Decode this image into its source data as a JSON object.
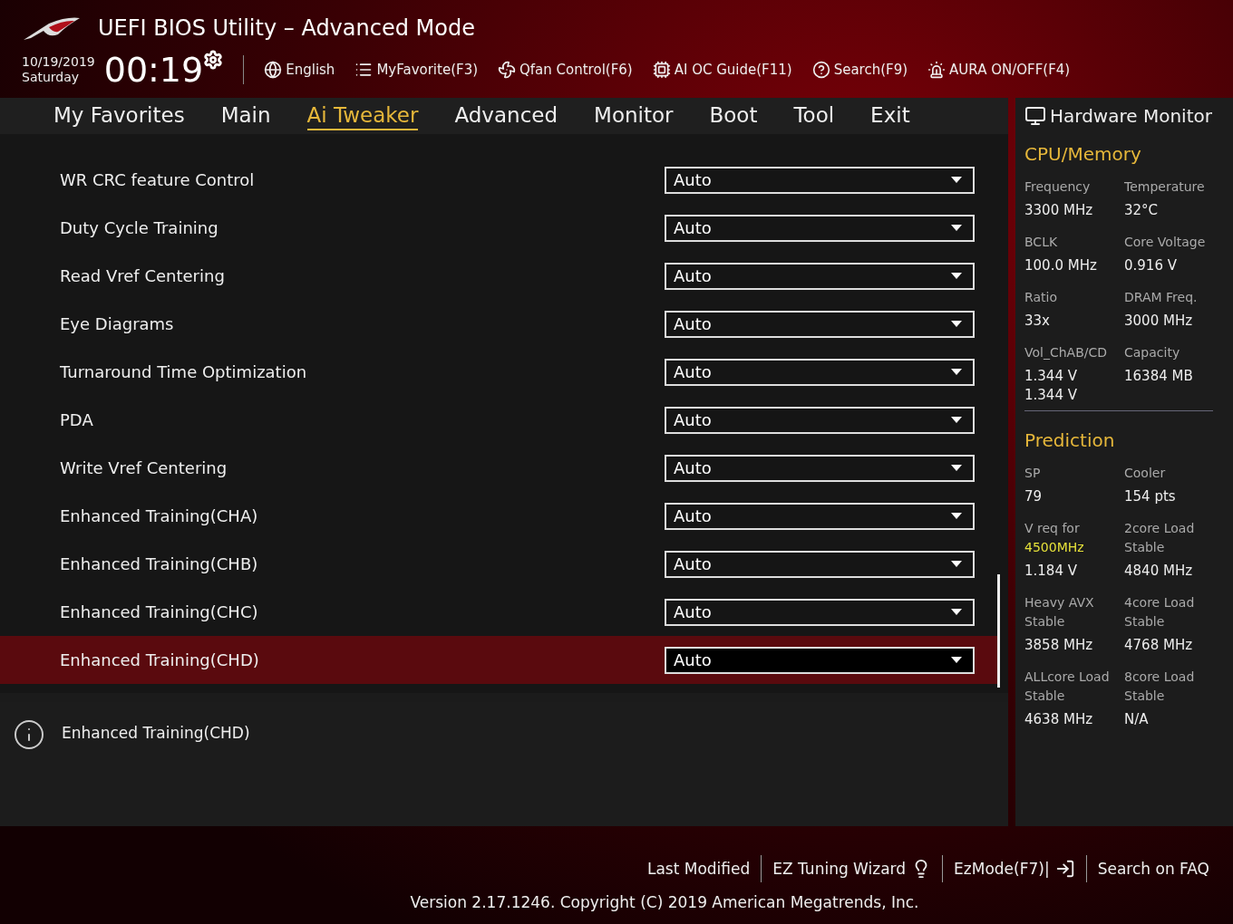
{
  "window": {
    "title": "UEFI BIOS Utility – Advanced Mode"
  },
  "clock": {
    "date": "10/19/2019",
    "day": "Saturday",
    "time": "00:19"
  },
  "toolbar": [
    {
      "label": "English"
    },
    {
      "label": "MyFavorite(F3)"
    },
    {
      "label": "Qfan Control(F6)"
    },
    {
      "label": "AI OC Guide(F11)"
    },
    {
      "label": "Search(F9)"
    },
    {
      "label": "AURA ON/OFF(F4)"
    }
  ],
  "tabs": [
    {
      "label": "My Favorites",
      "selected": false
    },
    {
      "label": "Main",
      "selected": false
    },
    {
      "label": "Ai Tweaker",
      "selected": true
    },
    {
      "label": "Advanced",
      "selected": false
    },
    {
      "label": "Monitor",
      "selected": false
    },
    {
      "label": "Boot",
      "selected": false
    },
    {
      "label": "Tool",
      "selected": false
    },
    {
      "label": "Exit",
      "selected": false
    }
  ],
  "settings": [
    {
      "label": "WR CRC feature Control",
      "value": "Auto",
      "selected": false
    },
    {
      "label": "Duty Cycle Training",
      "value": "Auto",
      "selected": false
    },
    {
      "label": "Read Vref Centering",
      "value": "Auto",
      "selected": false
    },
    {
      "label": "Eye Diagrams",
      "value": "Auto",
      "selected": false
    },
    {
      "label": "Turnaround Time Optimization",
      "value": "Auto",
      "selected": false
    },
    {
      "label": "PDA",
      "value": "Auto",
      "selected": false
    },
    {
      "label": "Write Vref Centering",
      "value": "Auto",
      "selected": false
    },
    {
      "label": "Enhanced Training(CHA)",
      "value": "Auto",
      "selected": false
    },
    {
      "label": "Enhanced Training(CHB)",
      "value": "Auto",
      "selected": false
    },
    {
      "label": "Enhanced Training(CHC)",
      "value": "Auto",
      "selected": false
    },
    {
      "label": "Enhanced Training(CHD)",
      "value": "Auto",
      "selected": true
    }
  ],
  "help": {
    "text": "Enhanced Training(CHD)"
  },
  "hardware_monitor": {
    "title": "Hardware Monitor",
    "sections": [
      {
        "title": "CPU/Memory",
        "cells": [
          {
            "label": "Frequency",
            "values": [
              "3300 MHz"
            ]
          },
          {
            "label": "Temperature",
            "values": [
              "32°C"
            ]
          },
          {
            "label": "BCLK",
            "values": [
              "100.0 MHz"
            ]
          },
          {
            "label": "Core Voltage",
            "values": [
              "0.916 V"
            ]
          },
          {
            "label": "Ratio",
            "values": [
              "33x"
            ]
          },
          {
            "label": "DRAM Freq.",
            "values": [
              "3000 MHz"
            ]
          },
          {
            "label": "Vol_ChAB/CD",
            "values": [
              "1.344 V",
              "1.344 V"
            ]
          },
          {
            "label": "Capacity",
            "values": [
              "16384 MB"
            ]
          }
        ]
      },
      {
        "title": "Prediction",
        "cells": [
          {
            "label": "SP",
            "values": [
              "79"
            ]
          },
          {
            "label": "Cooler",
            "values": [
              "154 pts"
            ]
          },
          {
            "label": "V req for",
            "highlight": "4500MHz",
            "values": [
              "1.184 V"
            ]
          },
          {
            "label": "2core Load Stable",
            "values": [
              "4840 MHz"
            ]
          },
          {
            "label": "Heavy AVX Stable",
            "values": [
              "3858 MHz"
            ]
          },
          {
            "label": "4core Load Stable",
            "values": [
              "4768 MHz"
            ]
          },
          {
            "label": "ALLcore Load Stable",
            "values": [
              "4638 MHz"
            ]
          },
          {
            "label": "8core Load Stable",
            "values": [
              "N/A"
            ]
          }
        ]
      }
    ]
  },
  "footer": {
    "links": [
      {
        "label": "Last Modified"
      },
      {
        "label": "EZ Tuning Wizard"
      },
      {
        "label": "EzMode(F7)|"
      },
      {
        "label": "Search on FAQ"
      }
    ],
    "version": "Version 2.17.1246. Copyright (C) 2019 American Megatrends, Inc."
  }
}
